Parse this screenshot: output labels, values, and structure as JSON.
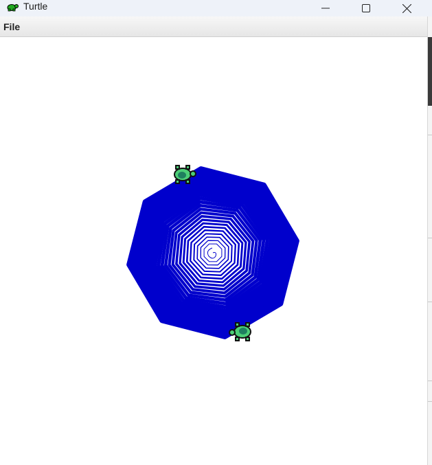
{
  "window": {
    "title": "Turtle",
    "app_icon": "turtle-icon",
    "controls": [
      "minimize-icon",
      "maximize-icon",
      "close-icon"
    ]
  },
  "menu": {
    "items": [
      {
        "label": "File"
      }
    ]
  },
  "canvas": {
    "background": "#ffffff",
    "pen_color": "#0000cc",
    "shape": "octagon spiral",
    "turtles": [
      {
        "name": "turtle-1",
        "color": "#4ccf77"
      },
      {
        "name": "turtle-2",
        "color": "#4ccf77"
      }
    ]
  }
}
